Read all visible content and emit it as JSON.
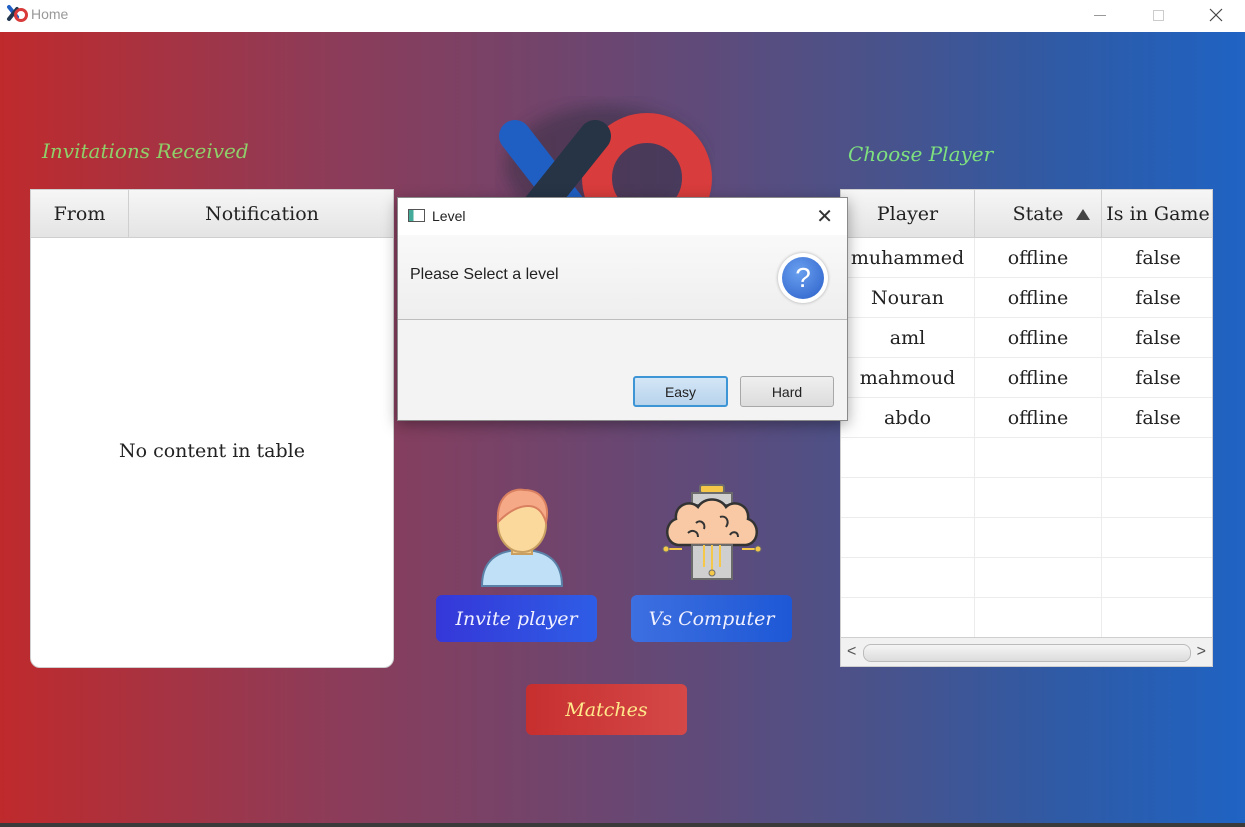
{
  "window": {
    "title": "Home",
    "minimize_glyph": "",
    "close_glyph": "✕"
  },
  "invitations": {
    "title": "Invitations Received",
    "columns": [
      "From",
      "Notification"
    ],
    "empty_message": "No content in table"
  },
  "dialog": {
    "title": "Level",
    "close_glyph": "✕",
    "message": "Please Select a level",
    "help_glyph": "?",
    "buttons": {
      "easy": "Easy",
      "hard": "Hard"
    }
  },
  "actions": {
    "invite": "Invite player",
    "vs_computer": "Vs Computer",
    "matches": "Matches"
  },
  "players": {
    "title": "Choose Player",
    "columns": [
      "Player",
      "State",
      "Is in Game"
    ],
    "sort_column": "State",
    "rows": [
      [
        "muhammed",
        "offline",
        "false"
      ],
      [
        "Nouran",
        "offline",
        "false"
      ],
      [
        "aml",
        "offline",
        "false"
      ],
      [
        "mahmoud",
        "offline",
        "false"
      ],
      [
        "abdo",
        "offline",
        "false"
      ],
      [
        "",
        "",
        ""
      ],
      [
        "",
        "",
        ""
      ],
      [
        "",
        "",
        ""
      ],
      [
        "",
        "",
        ""
      ],
      [
        "",
        "",
        ""
      ]
    ],
    "scroll_left": "<",
    "scroll_right": ">"
  },
  "colors": {
    "gradient_left": "#bf2a2c",
    "gradient_right": "#1f63c3",
    "invites_title": "#8fcf6a",
    "choose_title": "#7ee07e",
    "matches_text": "#ffe98a"
  }
}
